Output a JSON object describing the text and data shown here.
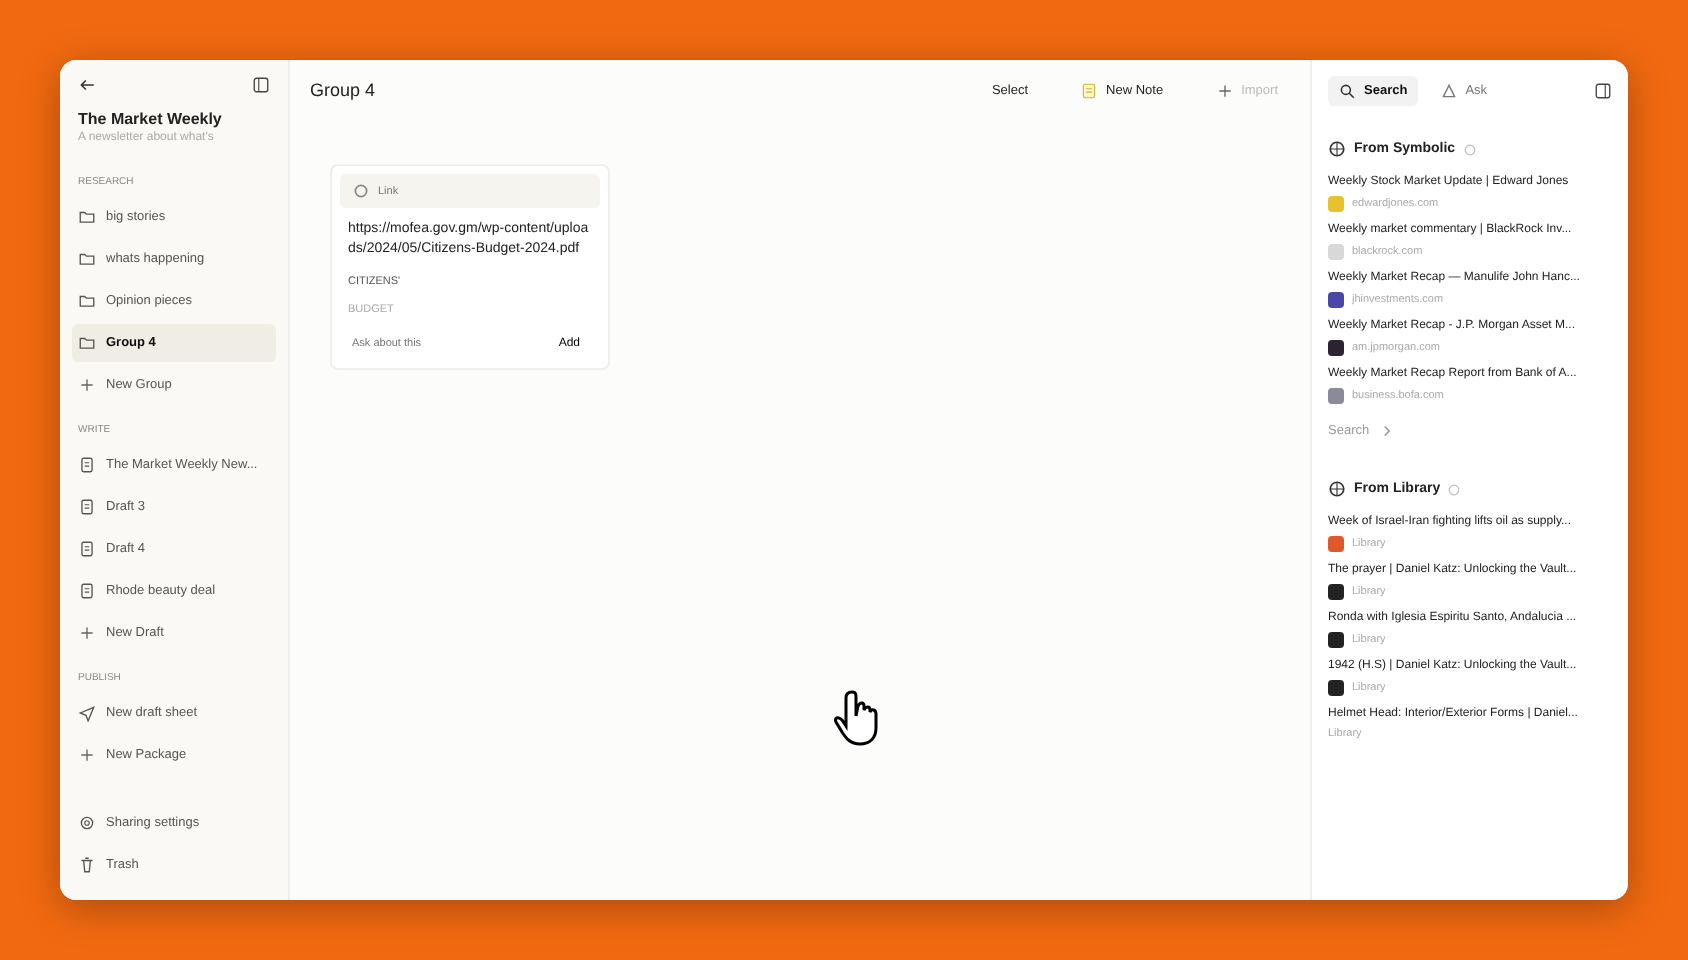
{
  "sidebar": {
    "title": "The Market Weekly",
    "subtitle": "A newsletter about what's",
    "sections": [
      {
        "label": "RESEARCH",
        "items": [
          {
            "kind": "folder",
            "label": "big stories",
            "selected": false
          },
          {
            "kind": "folder",
            "label": "whats happening",
            "selected": false
          },
          {
            "kind": "folder",
            "label": "Opinion pieces",
            "selected": false
          },
          {
            "kind": "folder",
            "label": "Group 4",
            "selected": true
          },
          {
            "kind": "add",
            "label": "New Group",
            "selected": false
          }
        ]
      },
      {
        "label": "WRITE",
        "items": [
          {
            "kind": "doc",
            "label": "The Market Weekly New...",
            "selected": false
          },
          {
            "kind": "doc",
            "label": "Draft 3",
            "selected": false
          },
          {
            "kind": "doc",
            "label": "Draft 4",
            "selected": false
          },
          {
            "kind": "doc",
            "label": "Rhode beauty deal",
            "selected": false
          },
          {
            "kind": "add",
            "label": "New Draft",
            "selected": false
          }
        ]
      },
      {
        "label": "PUBLISH",
        "items": [
          {
            "kind": "send",
            "label": "New draft sheet",
            "selected": false
          },
          {
            "kind": "add",
            "label": "New Package",
            "selected": false
          }
        ]
      }
    ],
    "footer": [
      {
        "kind": "gear",
        "label": "Sharing settings"
      },
      {
        "kind": "trash",
        "label": "Trash"
      }
    ]
  },
  "main": {
    "title": "Group 4",
    "toolbar": [
      {
        "kind": "plain",
        "label": "Select",
        "disabled": false
      },
      {
        "kind": "note",
        "label": "New Note",
        "disabled": false
      },
      {
        "kind": "add",
        "label": "Import",
        "disabled": true
      }
    ],
    "card": {
      "tag": "Link",
      "url": "https://mofea.gov.gm/wp-content/uploads/2024/05/Citizens-Budget-2024.pdf",
      "lines": [
        "CITIZENS'",
        "BUDGET"
      ],
      "placeholder": "Ask about this",
      "button": "Add"
    }
  },
  "panel": {
    "tabs": [
      {
        "kind": "search",
        "label": "Search",
        "selected": true
      },
      {
        "kind": "ask",
        "label": "Ask",
        "selected": false
      }
    ],
    "symbolic": {
      "title": "From Symbolic",
      "items": [
        {
          "title": "Weekly Stock Market Update | Edward Jones",
          "source": "edwardjones.com",
          "color": "#e8c22c"
        },
        {
          "title": "Weekly market commentary | BlackRock Inv...",
          "source": "blackrock.com",
          "color": "#d8d8d8"
        },
        {
          "title": "Weekly Market Recap — Manulife John Hanc...",
          "source": "jhinvestments.com",
          "color": "#4a47a8"
        },
        {
          "title": "Weekly Market Recap - J.P. Morgan Asset M...",
          "source": "am.jpmorgan.com",
          "color": "#2b2330"
        },
        {
          "title": "Weekly Market Recap Report from Bank of A...",
          "source": "business.bofa.com",
          "color": "#8a8a9a"
        }
      ],
      "more": "Search"
    },
    "library": {
      "title": "From Library",
      "items": [
        {
          "title": "Week of Israel-Iran fighting lifts oil as supply...",
          "source": "Library",
          "color": "#e0572a"
        },
        {
          "title": "The prayer | Daniel Katz: Unlocking the Vault...",
          "source": "Library",
          "color": "#222222"
        },
        {
          "title": "Ronda with Iglesia Espiritu Santo, Andalucia ...",
          "source": "Library",
          "color": "#222222"
        },
        {
          "title": "1942 (H.S) | Daniel Katz: Unlocking the Vault...",
          "source": "Library",
          "color": "#222222"
        },
        {
          "title": "Helmet Head: Interior/Exterior Forms | Daniel...",
          "source": "Library"
        }
      ]
    }
  }
}
